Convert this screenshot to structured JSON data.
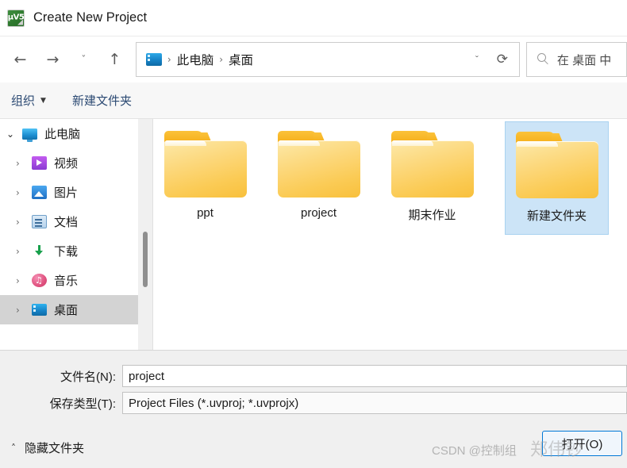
{
  "window": {
    "title": "Create New Project",
    "app_icon": "keil-uvision-icon",
    "app_icon_glyph": "µV5"
  },
  "nav": {
    "back_icon": "←",
    "forward_icon": "→",
    "recent_icon": "ˇ",
    "up_icon": "↑",
    "dropdown_icon": "ˇ",
    "refresh_icon": "⟳",
    "breadcrumb": {
      "icon": "desktop-icon",
      "separator": "›",
      "items": [
        "此电脑",
        "桌面"
      ]
    }
  },
  "search": {
    "icon": "search-icon",
    "placeholder": "在 桌面 中"
  },
  "commandbar": {
    "organize_label": "组织",
    "organize_caret": "▼",
    "new_folder_label": "新建文件夹"
  },
  "sidebar": {
    "scrollbar": "vertical-scrollbar",
    "items": [
      {
        "label": "此电脑",
        "icon": "computer-icon",
        "icon_class": "ic-pc",
        "chevron": "⌄",
        "expanded": true,
        "selected": false,
        "level": 1
      },
      {
        "label": "视频",
        "icon": "video-icon",
        "icon_class": "ic-video",
        "chevron": "›",
        "expanded": false,
        "selected": false,
        "level": 2
      },
      {
        "label": "图片",
        "icon": "pictures-icon",
        "icon_class": "ic-pic",
        "chevron": "›",
        "expanded": false,
        "selected": false,
        "level": 2
      },
      {
        "label": "文档",
        "icon": "documents-icon",
        "icon_class": "ic-doc",
        "chevron": "›",
        "expanded": false,
        "selected": false,
        "level": 2
      },
      {
        "label": "下载",
        "icon": "downloads-icon",
        "icon_class": "ic-down",
        "chevron": "›",
        "expanded": false,
        "selected": false,
        "level": 2
      },
      {
        "label": "音乐",
        "icon": "music-icon",
        "icon_class": "ic-music",
        "chevron": "›",
        "expanded": false,
        "selected": false,
        "level": 2
      },
      {
        "label": "桌面",
        "icon": "desktop-icon",
        "icon_class": "ic-desk",
        "chevron": "›",
        "expanded": false,
        "selected": true,
        "level": 2
      }
    ]
  },
  "filelist": {
    "items": [
      {
        "name": "ppt",
        "icon": "folder-icon",
        "selected": false
      },
      {
        "name": "project",
        "icon": "folder-icon",
        "selected": false
      },
      {
        "name": "期末作业",
        "icon": "folder-icon",
        "selected": false
      },
      {
        "name": "新建文件夹",
        "icon": "folder-icon",
        "selected": true
      }
    ]
  },
  "form": {
    "filename_label": "文件名(N):",
    "filename_value": "project",
    "filetype_label": "保存类型(T):",
    "filetype_value": "Project Files (*.uvproj; *.uvprojx)"
  },
  "footer": {
    "hide_folders_label": "隐藏文件夹",
    "hide_folders_chevron": "˄",
    "open_button_label": "打开(O)"
  },
  "watermarks": {
    "csdn": "CSDN @控制组",
    "author": "郑伟钞"
  },
  "colors": {
    "accent": "#0078d7",
    "selection_file": "#cce4f7",
    "selection_tree": "#d3d3d3",
    "folder_yellow": "#fbcb55",
    "command_text": "#2c4a73"
  }
}
